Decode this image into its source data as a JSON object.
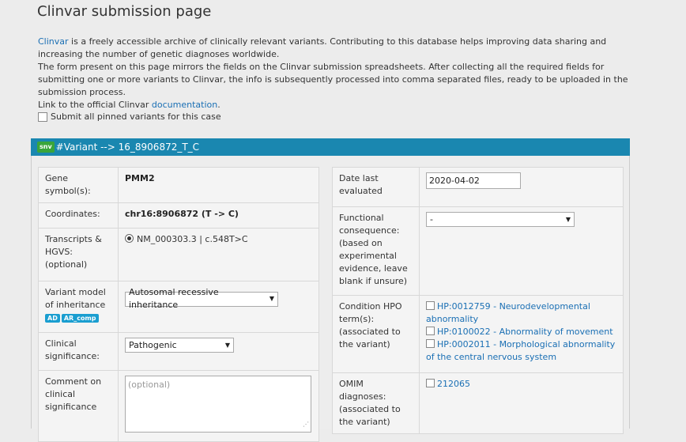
{
  "page": {
    "title": "Clinvar submission page"
  },
  "intro": {
    "clinvar_link": "Clinvar",
    "line1_rest": " is a freely accessible archive of clinically relevant variants. Contributing to this database helps improving data sharing and increasing the number of genetic diagnoses worldwide.",
    "line2": "The form present on this page mirrors the fields on the Clinvar submission spreadsheets. After collecting all the required fields for submitting one or more variants to Clinvar, the info is subsequently processed into comma separated files, ready to be uploaded in the submission process.",
    "line3_prefix": "Link to the official Clinvar ",
    "doc_link": "documentation",
    "line3_suffix": "."
  },
  "pin_all": {
    "label": "Submit all pinned variants for this case",
    "checked": false
  },
  "variant": {
    "badge": "snv",
    "header": "#Variant --> 16_8906872_T_C"
  },
  "left": {
    "gene_label": "Gene symbol(s):",
    "gene_value": "PMM2",
    "coord_label": "Coordinates:",
    "coord_value": "chr16:8906872 (T -> C)",
    "transcripts_label": "Transcripts & HGVS: (optional)",
    "transcript_value": "NM_000303.3 | c.548T>C",
    "inheritance_label": "Variant model of inheritance",
    "inheritance_tags": [
      "AD",
      "AR_comp"
    ],
    "inheritance_value": "Autosomal recessive inheritance",
    "significance_label": "Clinical significance:",
    "significance_value": "Pathogenic",
    "comment_label": "Comment on clinical significance",
    "comment_placeholder": "(optional)"
  },
  "right": {
    "date_label": "Date last evaluated",
    "date_value": "2020-04-02",
    "functional_label": "Functional consequence: (based on experimental evidence, leave blank if unsure)",
    "functional_value": "-",
    "hpo_label": "Condition HPO term(s): (associated to the variant)",
    "hpo_terms": [
      "HP:0012759 - Neurodevelopmental abnormality",
      "HP:0100022 - Abnormality of movement",
      "HP:0002011 - Morphological abnormality of the central nervous system"
    ],
    "omim_label": "OMIM diagnoses: (associated to the variant)",
    "omim_values": [
      "212065"
    ]
  }
}
